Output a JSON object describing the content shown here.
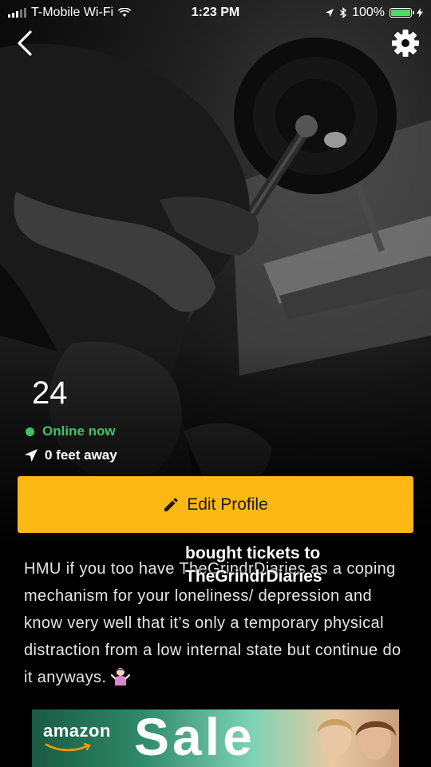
{
  "status_bar": {
    "carrier": "T-Mobile Wi-Fi",
    "time": "1:23 PM",
    "battery": "100%"
  },
  "icons": {
    "back": "chevron-left-icon",
    "settings": "gear-icon",
    "location": "location-arrow-icon",
    "edit": "pencil-icon"
  },
  "profile": {
    "age": "24",
    "status": "Online now",
    "distance": "0 feet away",
    "status_color": "#3cc36a"
  },
  "edit_button": {
    "label": "Edit Profile",
    "color": "#fdb813"
  },
  "bio": {
    "text": "HMU if you too have TheGrindrDiaries as a coping mechanism for your loneliness/ depression and know very well that it’s only a temporary physical distraction from a low internal state but continue do it anyways.",
    "emoji": "🤷🏻‍♀️"
  },
  "caption": {
    "line1": "bought tickets to",
    "line2": "TheGrindrDiaries"
  },
  "ad": {
    "brand": "amazon",
    "headline": "Sale"
  }
}
